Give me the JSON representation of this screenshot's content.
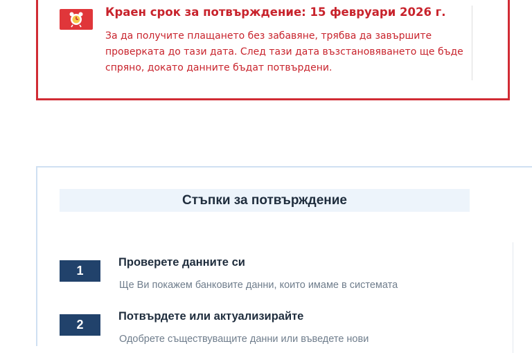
{
  "alert": {
    "icon": "alarm-clock-icon",
    "title": "Краен срок за потвърждение: 15 февруари 2026 г.",
    "text": "За да получите плащането без забавяне, трябва да завършите проверката до тази дата. След тази дата възстановяването ще бъде спряно, докато данните бъдат потвърдени.",
    "color": "#d12b34"
  },
  "steps": {
    "title": "Стъпки за потвърждение",
    "items": [
      {
        "number": "1",
        "title": "Проверете данните си",
        "description": "Ще Ви покажем банковите данни, които имаме в системата"
      },
      {
        "number": "2",
        "title": "Потвърдете или актуализирайте",
        "description": "Одобрете съществуващите данни или въведете нови"
      }
    ],
    "accent": "#21426b"
  }
}
